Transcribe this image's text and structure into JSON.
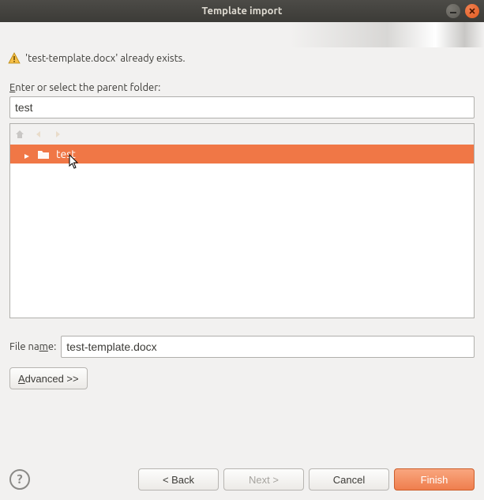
{
  "window": {
    "title": "Template import"
  },
  "warning": {
    "message": "'test-template.docx' already exists."
  },
  "folder": {
    "label": "Enter or select the parent folder:",
    "value": "test"
  },
  "nav": {
    "home": "home-icon",
    "back": "back-icon",
    "forward": "forward-icon"
  },
  "tree": {
    "items": [
      {
        "label": "test",
        "selected": true
      }
    ]
  },
  "filename": {
    "label_pre": "File na",
    "label_mid": "m",
    "label_post": "e:",
    "value": "test-template.docx"
  },
  "advanced": {
    "label_pre": "A",
    "label_rest": "dvanced >>"
  },
  "buttons": {
    "help": "?",
    "back": "< Back",
    "next": "Next >",
    "cancel": "Cancel",
    "finish": "Finish"
  }
}
